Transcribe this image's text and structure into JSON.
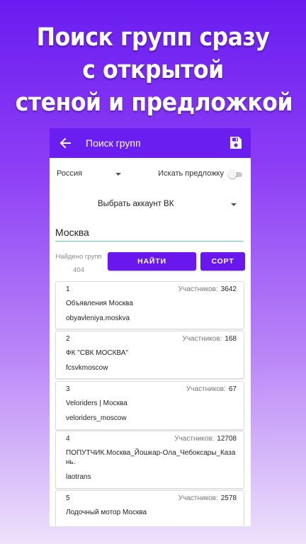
{
  "promo": {
    "line1": "Поиск групп сразу",
    "line2": "с открытой",
    "line3": "стеной и предложкой"
  },
  "appbar": {
    "title": "Поиск групп",
    "back_icon": "arrow-back-icon",
    "save_icon": "save-icon"
  },
  "filters": {
    "country": "Россия",
    "suggest_label": "Искать предложку",
    "suggest_enabled": false,
    "account_label": "Выбрать аккаунт ВК"
  },
  "search": {
    "value": "Москва"
  },
  "results": {
    "found_label": "Найдено групп",
    "found_count": "404",
    "find_button": "НАЙТИ",
    "sort_button": "СОРТ"
  },
  "members_label": "Участников:",
  "groups": [
    {
      "num": "1",
      "members": "3642",
      "name": "Объявления Москва",
      "screen_name": "obyavleniya.moskva"
    },
    {
      "num": "2",
      "members": "168",
      "name": "ФК \"СВК МОСКВА\"",
      "screen_name": "fcsvkmoscow"
    },
    {
      "num": "3",
      "members": "67",
      "name": "Veloriders | Москва",
      "screen_name": "veloriders_moscow"
    },
    {
      "num": "4",
      "members": "12708",
      "name": "ПОПУТЧИК.Москва_Йошкар-Ола_Чебоксары_Казань.",
      "screen_name": "laotrans"
    },
    {
      "num": "5",
      "members": "2578",
      "name": "Лодочный мотор Москва",
      "screen_name": ""
    }
  ]
}
